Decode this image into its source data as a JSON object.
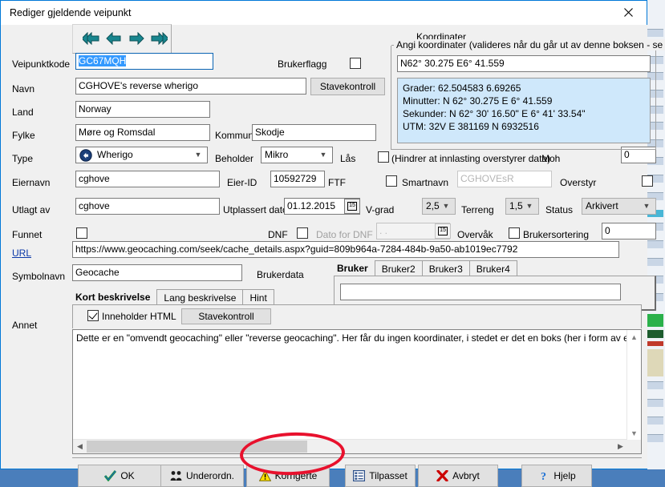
{
  "window": {
    "title": "Rediger gjeldende veipunkt",
    "close_icon": "close-icon"
  },
  "nav": {
    "first_label": "«",
    "prev_label": "‹",
    "next_label": "›",
    "last_label": "»"
  },
  "fields": {
    "waypoint_code": {
      "label": "Veipunktkode",
      "value": "GC67MQH"
    },
    "name": {
      "label": "Navn",
      "value": "CGHOVE's reverse wherigo"
    },
    "country": {
      "label": "Land",
      "value": "Norway"
    },
    "county": {
      "label": "Fylke",
      "value": "Møre og Romsdal"
    },
    "municipality": {
      "label": "Kommune",
      "value": "Skodje"
    },
    "type": {
      "label": "Type",
      "value": "Wherigo",
      "icon": "wherigo-icon"
    },
    "container": {
      "label": "Beholder",
      "value": "Mikro"
    },
    "owner_name": {
      "label": "Eiernavn",
      "value": "cghove"
    },
    "owner_id": {
      "label": "Eier-ID",
      "value": "10592729"
    },
    "ftf": {
      "label": "FTF"
    },
    "placed_by": {
      "label": "Utlagt av",
      "value": "cghove"
    },
    "placed_date": {
      "label": "Utplassert dato",
      "value": "01.12.2015"
    },
    "found": {
      "label": "Funnet",
      "checked": false
    },
    "dnf": {
      "label": "DNF",
      "checked": false
    },
    "dnf_date": {
      "label": "Dato for DNF",
      "value": ".  ."
    },
    "url": {
      "label": "URL",
      "value": "https://www.geocaching.com/seek/cache_details.aspx?guid=809b964a-7284-484b-9a50-ab1019ec7792"
    },
    "symbol_name": {
      "label": "Symbolnavn",
      "value": "Geocache"
    },
    "user_flag": {
      "label": "Brukerflagg",
      "checked": false
    },
    "lock": {
      "label": "Lås",
      "hint": "(Hindrer at innlasting overstyrer data)",
      "checked": false
    },
    "moh": {
      "label": "Moh",
      "value": "0"
    },
    "smart_name": {
      "label": "Smartnavn",
      "checked": false,
      "placeholder": "CGHOVEsR"
    },
    "override": {
      "label": "Overstyr",
      "checked": false
    },
    "difficulty": {
      "label": "V-grad",
      "value": "2,5"
    },
    "terrain": {
      "label": "Terreng",
      "value": "1,5"
    },
    "status": {
      "label": "Status",
      "value": "Arkivert"
    },
    "watch": {
      "label": "Overvåk"
    },
    "user_sort": {
      "label": "Brukersortering",
      "checked": false,
      "value": "0"
    },
    "user_data": {
      "label": "Brukerdata"
    }
  },
  "user_tabs": {
    "items": [
      "Bruker",
      "Bruker2",
      "Bruker3",
      "Bruker4"
    ],
    "active_index": 0,
    "value": ""
  },
  "desc": {
    "label": "Annet",
    "tabs": [
      "Kort beskrivelse",
      "Lang beskrivelse",
      "Hint"
    ],
    "active_index": 0,
    "contains_html": {
      "label": "Inneholder HTML",
      "checked": true
    },
    "spellcheck_label": "Stavekontroll",
    "text": "Dette er en \"omvendt geocaching\" eller \"reverse geocaching\". Her får du ingen koordinater, i stedet er det en boks (her i form av en Whereigo-cartrid"
  },
  "spellcheck_top": {
    "label": "Stavekontroll"
  },
  "coords": {
    "title": "Koordinater",
    "group_title": "Angi koordinater (valideres når du går ut av denne boksen - se Hjelp)",
    "value": "N62° 30.275  E6° 41.559",
    "info": [
      "Grader:  62.504583  6.69265",
      "Minutter:  N 62° 30.275  E 6° 41.559",
      "Sekunder:  N 62° 30' 16.50\"  E 6° 41' 33.54\"",
      "UTM:  32V  E 381169  N 6932516"
    ]
  },
  "buttons": [
    {
      "label": "OK",
      "icon": "check-icon"
    },
    {
      "label": "Underordn.",
      "icon": "people-icon"
    },
    {
      "label": "Korrigerte",
      "icon": "warning-icon"
    },
    {
      "label": "Tilpasset",
      "icon": "list-icon"
    },
    {
      "label": "Avbryt",
      "icon": "x-icon"
    },
    {
      "label": "Hjelp",
      "icon": "question-icon"
    }
  ],
  "colors": {
    "accent": "#0078d7",
    "annotation": "#e8112d",
    "arrow_teal": "#18868f",
    "coord_info_bg": "#cfe8fb",
    "selection": "#3399ff"
  }
}
